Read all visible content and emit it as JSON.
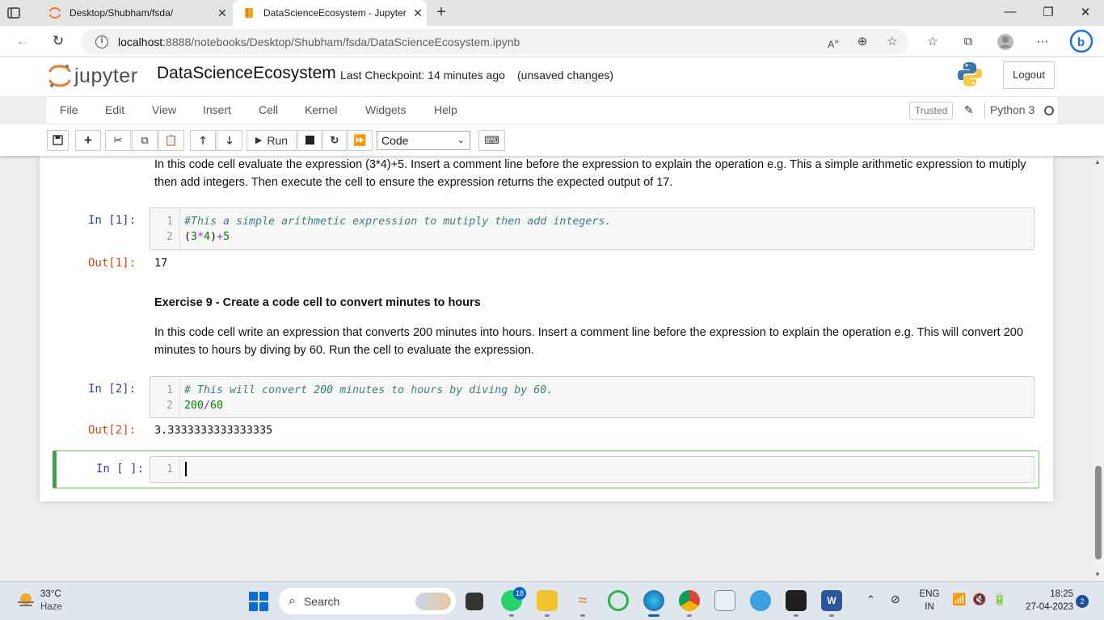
{
  "browser": {
    "tabs": [
      {
        "title": "Desktop/Shubham/fsda/",
        "active": false
      },
      {
        "title": "DataScienceEcosystem - Jupyter",
        "active": true
      }
    ],
    "url_host": "localhost",
    "url_path": ":8888/notebooks/Desktop/Shubham/fsda/DataScienceEcosystem.ipynb"
  },
  "jupyter": {
    "logo_text": "jupyter",
    "notebook_title": "DataScienceEcosystem",
    "checkpoint": "Last Checkpoint: 14 minutes ago",
    "unsaved": "(unsaved changes)",
    "logout": "Logout",
    "menu": [
      "File",
      "Edit",
      "View",
      "Insert",
      "Cell",
      "Kernel",
      "Widgets",
      "Help"
    ],
    "trusted": "Trusted",
    "kernel": "Python 3",
    "toolbar": {
      "run_label": "Run",
      "cell_type": "Code"
    }
  },
  "notebook": {
    "md1_text": "In this code cell evaluate the expression (3*4)+5. Insert a comment line before the expression to explain the operation e.g. This a simple arithmetic expression to mutiply then add integers. Then execute the cell to ensure the expression returns the expected output of 17.",
    "cell1": {
      "prompt_in": "In [1]:",
      "line_numbers": [
        "1",
        "2"
      ],
      "line1_comment": "#This a simple arithmetic expression to mutiply then add integers.",
      "line2": {
        "p1": "(",
        "n1": "3",
        "op1": "*",
        "n2": "4",
        "p2": ")",
        "op2": "+",
        "n3": "5"
      },
      "prompt_out": "Out[1]:",
      "output": "17"
    },
    "exercise9_heading": "Exercise 9 - Create a code cell to convert minutes to hours",
    "md2_text": "In this code cell write an expression that converts 200 minutes into hours. Insert a comment line before the expression to explain the operation e.g. This will convert 200 minutes to hours by diving by 60. Run the cell to evaluate the expression.",
    "cell2": {
      "prompt_in": "In [2]:",
      "line_numbers": [
        "1",
        "2"
      ],
      "line1_comment": "# This will convert 200 minutes to hours by diving by 60.",
      "line2": {
        "n1": "200",
        "op": "/",
        "n2": "60"
      },
      "prompt_out": "Out[2]:",
      "output": "3.3333333333333335"
    },
    "cell3": {
      "prompt_in": "In [ ]:",
      "line_number": "1"
    }
  },
  "taskbar": {
    "weather_temp": "33°C",
    "weather_desc": "Haze",
    "search": "Search",
    "whatsapp_badge": "18",
    "lang_line1": "ENG",
    "lang_line2": "IN",
    "time": "18:25",
    "date": "27-04-2023",
    "notification_count": "2"
  },
  "colors": {
    "accent_blue": "#303f9f",
    "out_red": "#d84315",
    "selected_green": "#42a047",
    "jupyter_orange": "#f37726"
  }
}
